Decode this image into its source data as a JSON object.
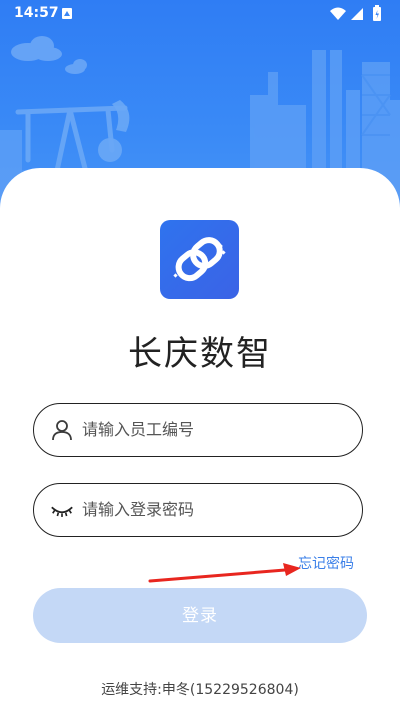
{
  "status_bar": {
    "time": "14:57"
  },
  "app": {
    "title": "长庆数智"
  },
  "login_form": {
    "employee_id_placeholder": "请输入员工编号",
    "password_placeholder": "请输入登录密码",
    "forgot_password_label": "忘记密码",
    "login_button_label": "登录"
  },
  "footer": {
    "support_text": "运维支持:申冬(15229526804)"
  },
  "icons": {
    "status": [
      "notification-icon",
      "wifi-icon",
      "cellular-signal-icon",
      "battery-icon"
    ],
    "employee_field": "user-icon",
    "password_field": "closed-eye-icon",
    "logo": "chain-link-icon"
  },
  "colors": {
    "header_gradient_top": "#2f7df4",
    "header_gradient_bottom": "#4b97f7",
    "logo_background": "#2f73ee",
    "link": "#3a7fe8",
    "button_disabled": "#c4d8f6",
    "annotation_arrow": "#e8261f"
  }
}
